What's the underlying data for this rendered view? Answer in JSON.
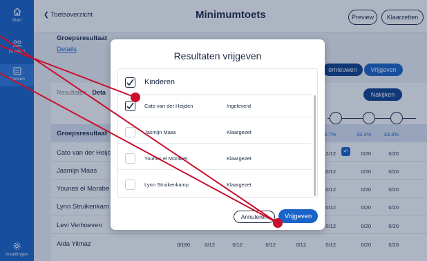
{
  "nav": {
    "items": [
      {
        "label": "Start",
        "icon": "home-icon"
      },
      {
        "label": "Groep 4",
        "icon": "group-icon"
      },
      {
        "label": "Toetsen",
        "icon": "test-icon"
      },
      {
        "label": "Instellingen",
        "icon": "gear-icon"
      }
    ]
  },
  "header": {
    "back_label": "Toetsoverzicht",
    "title": "Minimumtoets",
    "preview_label": "Preview",
    "ready_label": "Klaarzetten"
  },
  "background": {
    "group_title": "Groepsresultaat",
    "details_link": "Details",
    "renew_label": "ernieuwen",
    "release_label": "Vrijgeven",
    "check_label": "Nakijken",
    "tabs": {
      "results": "Resultaten",
      "detail": "Deta"
    },
    "group_row": {
      "label": "Groepsresultaat",
      "values": [
        "66.7%",
        "33.3%",
        "33.3%"
      ]
    },
    "students": [
      {
        "name": "Cato van der Heijc",
        "values": [
          "12/12",
          "0/20",
          "0/20"
        ]
      },
      {
        "name": "Jasmijn Maas",
        "values": [
          "0/12",
          "0/20",
          "0/20"
        ]
      },
      {
        "name": "Younes el Morabe",
        "values": [
          "0/12",
          "0/20",
          "0/20"
        ]
      },
      {
        "name": "Lynn Struikenkam",
        "values": [
          "0/12",
          "0/20",
          "0/20"
        ]
      },
      {
        "name": "Levi Verhoeven",
        "values": [
          "0/12",
          "0/20",
          "0/20"
        ]
      },
      {
        "name": "Aida Yilmaz",
        "values": [
          "0/180",
          "0/12",
          "0/12",
          "0/12",
          "0/12",
          "0/12",
          "0/20",
          "0/20"
        ]
      }
    ]
  },
  "modal": {
    "title": "Resultaten vrijgeven",
    "select_all_label": "Kinderen",
    "select_all_checked": true,
    "rows": [
      {
        "name": "Cato van der Heijden",
        "status": "Ingeleverd",
        "checked": true
      },
      {
        "name": "Jasmijn Maas",
        "status": "Klaargezet",
        "checked": false
      },
      {
        "name": "Younes el Morabet",
        "status": "Klaargezet",
        "checked": false
      },
      {
        "name": "Lynn Struikenkamp",
        "status": "Klaargezet",
        "checked": false
      }
    ],
    "cancel_label": "Annuleren",
    "release_label": "Vrijgeven"
  },
  "colors": {
    "nav_blue": "#1a63c8",
    "annotation_red": "#c8102e",
    "dark_navy": "#0f3f8a"
  }
}
